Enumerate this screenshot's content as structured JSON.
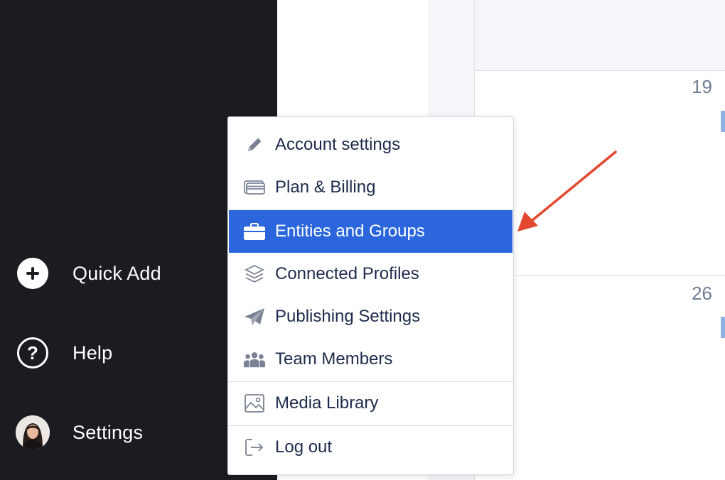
{
  "sidebar": {
    "items": [
      {
        "label": "Quick Add",
        "icon": "plus-circle-icon"
      },
      {
        "label": "Help",
        "icon": "help-circle-icon",
        "glyph": "?"
      },
      {
        "label": "Settings",
        "icon": "avatar"
      }
    ]
  },
  "calendar": {
    "days": [
      "19",
      "26"
    ]
  },
  "settings_menu": {
    "items": [
      {
        "label": "Account settings",
        "icon": "pencil-icon"
      },
      {
        "label": "Plan & Billing",
        "icon": "credit-card-icon"
      },
      {
        "label": "Entities and Groups",
        "icon": "briefcase-icon",
        "active": true
      },
      {
        "label": "Connected Profiles",
        "icon": "layers-icon"
      },
      {
        "label": "Publishing Settings",
        "icon": "paper-plane-icon"
      },
      {
        "label": "Team Members",
        "icon": "users-icon"
      },
      {
        "label": "Media Library",
        "icon": "image-icon"
      },
      {
        "label": "Log out",
        "icon": "log-out-icon"
      }
    ]
  },
  "colors": {
    "sidebar_bg": "#1b1c21",
    "menu_active_bg": "#2b66dc",
    "menu_text": "#1d2a4b",
    "annotation_arrow": "#e3472e"
  }
}
